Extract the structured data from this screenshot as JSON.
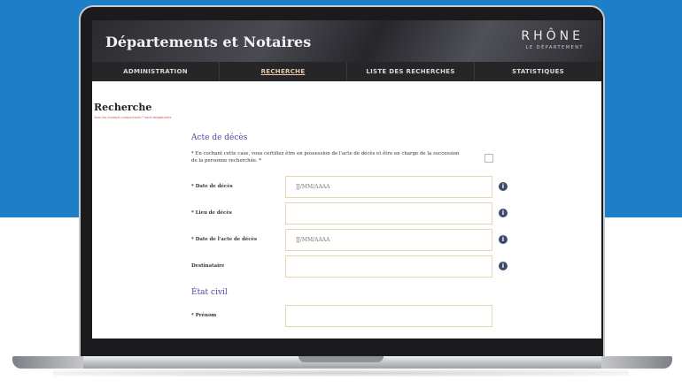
{
  "header": {
    "site_title": "Départements et Notaires",
    "logo_main": "RHÔNE",
    "logo_sub": "LE DÉPARTEMENT"
  },
  "nav": {
    "items": [
      {
        "label": "ADMINISTRATION"
      },
      {
        "label": "RECHERCHE"
      },
      {
        "label": "LISTE DES RECHERCHES"
      },
      {
        "label": "STATISTIQUES"
      }
    ]
  },
  "page": {
    "title": "Recherche",
    "required_note": "Tous les champs comportants * sont obligatoires"
  },
  "acte_deces": {
    "section_title": "Acte de décès",
    "certification_text": "* En cochant cette case, vous certifiez être en possession de l'acte de décès et être en charge de la succession de la personne recherchée. *",
    "fields": {
      "date_deces": {
        "label": "* Date de décès",
        "placeholder": "JJ/MM/AAAA"
      },
      "lieu_deces": {
        "label": "* Lieu de décès",
        "placeholder": ""
      },
      "date_acte": {
        "label": "* Date de l'acte de décès",
        "placeholder": "JJ/MM/AAAA"
      },
      "destinataire": {
        "label": "Destinataire",
        "placeholder": ""
      }
    }
  },
  "etat_civil": {
    "section_title": "État civil",
    "fields": {
      "prenom": {
        "label": "* Prénom",
        "placeholder": ""
      }
    }
  },
  "icons": {
    "info": "info-icon",
    "info_glyph": "i"
  },
  "colors": {
    "background_blue": "#1e7fc9",
    "nav_active": "#e8c9a8",
    "section_title": "#4a4aa0",
    "required_note": "#c2554a",
    "input_border": "#e6d6b4",
    "info_icon": "#3d4a6a"
  }
}
